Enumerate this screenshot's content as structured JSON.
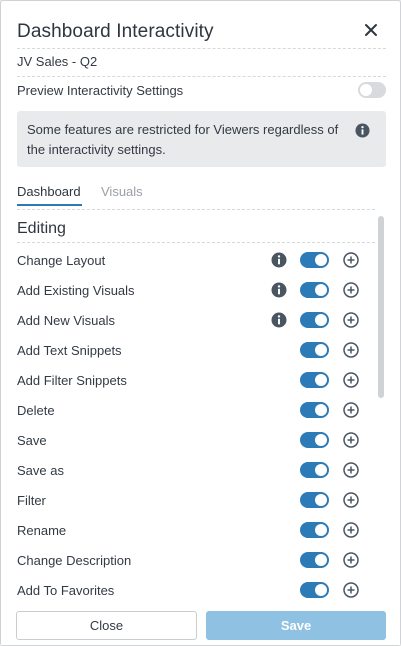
{
  "panel": {
    "title": "Dashboard Interactivity",
    "close_icon": "close-icon",
    "subtitle": "JV Sales - Q2",
    "preview": {
      "label": "Preview Interactivity Settings",
      "enabled": false
    },
    "notice": {
      "text": "Some features are restricted for Viewers regardless of the interactivity settings.",
      "icon": "info-icon"
    }
  },
  "tabs": [
    {
      "label": "Dashboard",
      "active": true
    },
    {
      "label": "Visuals",
      "active": false
    }
  ],
  "section": {
    "heading": "Editing",
    "items": [
      {
        "label": "Change Layout",
        "info": true,
        "enabled": true
      },
      {
        "label": "Add Existing Visuals",
        "info": true,
        "enabled": true
      },
      {
        "label": "Add New Visuals",
        "info": true,
        "enabled": true
      },
      {
        "label": "Add Text Snippets",
        "info": false,
        "enabled": true
      },
      {
        "label": "Add Filter Snippets",
        "info": false,
        "enabled": true
      },
      {
        "label": "Delete",
        "info": false,
        "enabled": true
      },
      {
        "label": "Save",
        "info": false,
        "enabled": true
      },
      {
        "label": "Save as",
        "info": false,
        "enabled": true
      },
      {
        "label": "Filter",
        "info": false,
        "enabled": true
      },
      {
        "label": "Rename",
        "info": false,
        "enabled": true
      },
      {
        "label": "Change Description",
        "info": false,
        "enabled": true
      },
      {
        "label": "Add To Favorites",
        "info": false,
        "enabled": true
      }
    ]
  },
  "footer": {
    "close_label": "Close",
    "save_label": "Save"
  },
  "colors": {
    "accent": "#2c7bb6",
    "save_disabled": "#8fc1e3",
    "notice_bg": "#e8eaec"
  }
}
